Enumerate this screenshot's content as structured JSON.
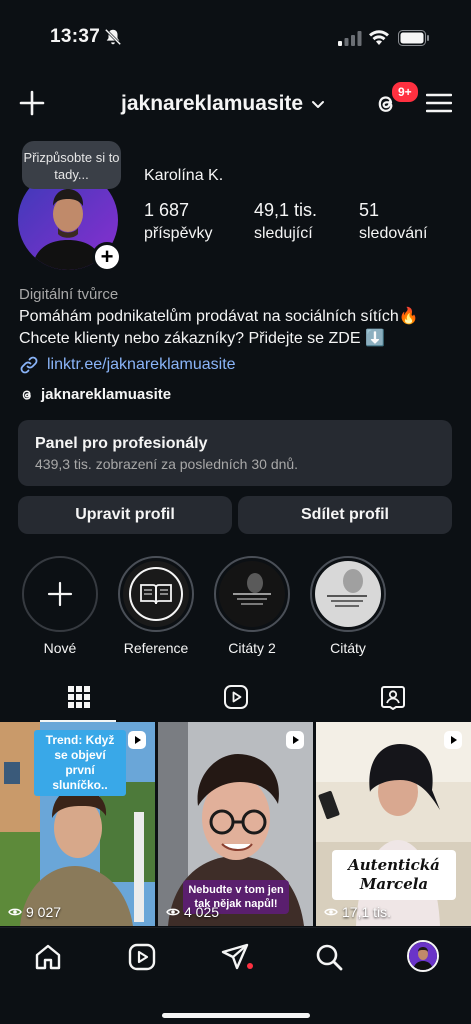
{
  "status_bar": {
    "time": "13:37"
  },
  "header": {
    "username": "jaknareklamuasite",
    "notification_badge": "9+"
  },
  "profile": {
    "tooltip": "Přizpůsobte si to tady...",
    "display_name": "Karolína K.",
    "stats": [
      {
        "value": "1 687",
        "label": "příspěvky"
      },
      {
        "value": "49,1 tis.",
        "label": "sledující"
      },
      {
        "value": "51",
        "label": "sledování"
      }
    ],
    "category": "Digitální tvůrce",
    "bio_line1": "Pomáhám podnikatelům prodávat na sociálních sítích🔥",
    "bio_line2": "Chcete klienty nebo zákazníky? Přidejte se ZDE ⬇️",
    "link": "linktr.ee/jaknareklamuasite",
    "threads_handle": "jaknareklamuasite"
  },
  "panel": {
    "title": "Panel pro profesionály",
    "subtitle": "439,3 tis. zobrazení za posledních 30 dnů."
  },
  "buttons": {
    "edit": "Upravit profil",
    "share": "Sdílet profil"
  },
  "highlights": [
    {
      "label": "Nové"
    },
    {
      "label": "Reference"
    },
    {
      "label": "Citáty 2"
    },
    {
      "label": "Citáty"
    }
  ],
  "tabs": [
    "grid-icon",
    "reels-icon",
    "tagged-icon"
  ],
  "posts": [
    {
      "caption": "Trend: Když se objeví první sluníčko..",
      "views": "9 027"
    },
    {
      "caption": "Nebudte v tom jen tak nějak napůl!",
      "views": "4 025"
    },
    {
      "caption": "Autentická Marcela",
      "views": "17,1 tis."
    }
  ],
  "bottom_nav": [
    "home-icon",
    "reels-icon",
    "messages-icon",
    "search-icon",
    "profile-avatar"
  ],
  "colors": {
    "background": "#0c1014",
    "card": "#262a31",
    "link": "#8ab4f8",
    "badge": "#ff3040"
  }
}
